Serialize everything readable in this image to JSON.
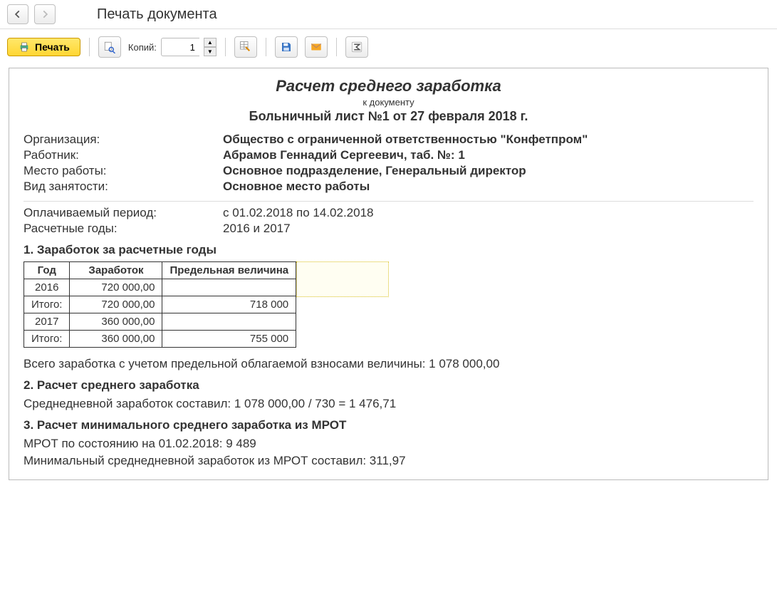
{
  "window": {
    "title": "Печать документа"
  },
  "toolbar": {
    "print_label": "Печать",
    "copies_label": "Копий:",
    "copies_value": "1"
  },
  "doc": {
    "title": "Расчет среднего заработка",
    "subtitle": "к документу",
    "doc_ref": "Больничный лист №1 от 27 февраля 2018 г.",
    "fields": {
      "org_label": "Организация:",
      "org_value": "Общество с ограниченной ответственностью \"Конфетпром\"",
      "employee_label": "Работник:",
      "employee_value": "Абрамов Геннадий Сергеевич, таб. №: 1",
      "workplace_label": "Место работы:",
      "workplace_value": "Основное подразделение, Генеральный директор",
      "emp_type_label": "Вид занятости:",
      "emp_type_value": "Основное место работы",
      "period_label": "Оплачиваемый период:",
      "period_value": "с 01.02.2018 по 14.02.2018",
      "years_label": "Расчетные годы:",
      "years_value": "2016 и 2017"
    },
    "section1": {
      "heading": "1. Заработок за расчетные годы",
      "headers": {
        "year": "Год",
        "earn": "Заработок",
        "limit": "Предельная величина"
      },
      "rows": [
        {
          "year": "2016",
          "earn": "720 000,00",
          "limit": ""
        },
        {
          "year": "Итого:",
          "earn": "720 000,00",
          "limit": "718 000",
          "is_total": true
        },
        {
          "year": "2017",
          "earn": "360 000,00",
          "limit": ""
        },
        {
          "year": "Итого:",
          "earn": "360 000,00",
          "limit": "755 000",
          "is_total": true
        }
      ],
      "summary": "Всего заработка с учетом предельной облагаемой взносами величины: 1 078 000,00"
    },
    "section2": {
      "heading": "2. Расчет среднего заработка",
      "text": "Среднедневной заработок составил: 1 078 000,00 / 730 = 1 476,71"
    },
    "section3": {
      "heading": "3. Расчет минимального среднего заработка из МРОТ",
      "line1": "МРОТ по состоянию на 01.02.2018: 9 489",
      "line2": "Минимальный среднедневной заработок из МРОТ составил: 311,97"
    }
  }
}
